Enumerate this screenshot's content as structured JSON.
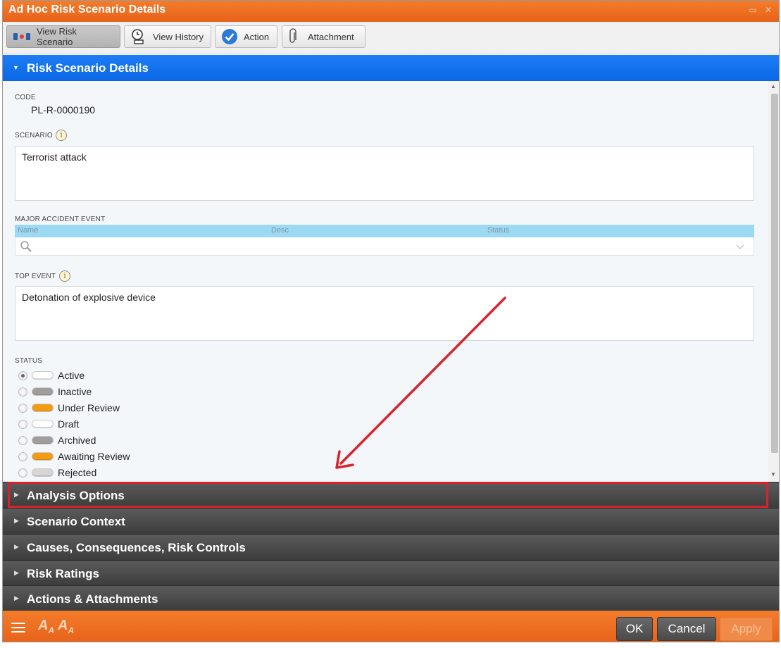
{
  "window": {
    "title": "Ad Hoc Risk Scenario Details",
    "controls": {
      "maximize": "▭",
      "close": "✕"
    }
  },
  "toolbar": {
    "buttons": [
      {
        "label": "View Risk Scenario",
        "icon": "risk-scenario-icon",
        "active": true
      },
      {
        "label": "View History",
        "icon": "history-icon",
        "active": false
      },
      {
        "label": "Action",
        "icon": "checkmark-circle-icon",
        "active": false
      },
      {
        "label": "Attachment",
        "icon": "paperclip-icon",
        "active": false
      }
    ]
  },
  "details_section": {
    "title": "Risk Scenario Details",
    "expanded": true,
    "code": {
      "label": "CODE",
      "value": "PL-R-0000190"
    },
    "scenario": {
      "label": "SCENARIO",
      "value": "Terrorist attack"
    },
    "major_accident_event": {
      "label": "MAJOR ACCIDENT EVENT",
      "columns": [
        "Name",
        "Desc",
        "Status"
      ]
    },
    "top_event": {
      "label": "TOP EVENT",
      "value": "Detonation of explosive device"
    },
    "status": {
      "label": "STATUS",
      "options": [
        {
          "label": "Active",
          "color": "#ffffff",
          "checked": true
        },
        {
          "label": "Inactive",
          "color": "#9e9e9e",
          "checked": false
        },
        {
          "label": "Under Review",
          "color": "#f39c12",
          "checked": false
        },
        {
          "label": "Draft",
          "color": "#ffffff",
          "checked": false
        },
        {
          "label": "Archived",
          "color": "#9e9e9e",
          "checked": false
        },
        {
          "label": "Awaiting Review",
          "color": "#f39c12",
          "checked": false
        },
        {
          "label": "Rejected",
          "color": "#d6d6d6",
          "checked": false
        }
      ]
    }
  },
  "accordion": [
    {
      "label": "Analysis Options",
      "highlighted": true
    },
    {
      "label": "Scenario Context",
      "highlighted": false
    },
    {
      "label": "Causes, Consequences, Risk Controls",
      "highlighted": false
    },
    {
      "label": "Risk Ratings",
      "highlighted": false
    },
    {
      "label": "Actions & Attachments",
      "highlighted": false
    }
  ],
  "footer": {
    "font_decrease": "A",
    "font_decrease_sub": "A",
    "font_increase": "A",
    "font_increase_sub": "A",
    "ok": "OK",
    "cancel": "Cancel",
    "apply": "Apply"
  },
  "colors": {
    "brand_orange": "#e8621a",
    "section_blue": "#0b67e6",
    "annotation_red": "#d8232e"
  }
}
